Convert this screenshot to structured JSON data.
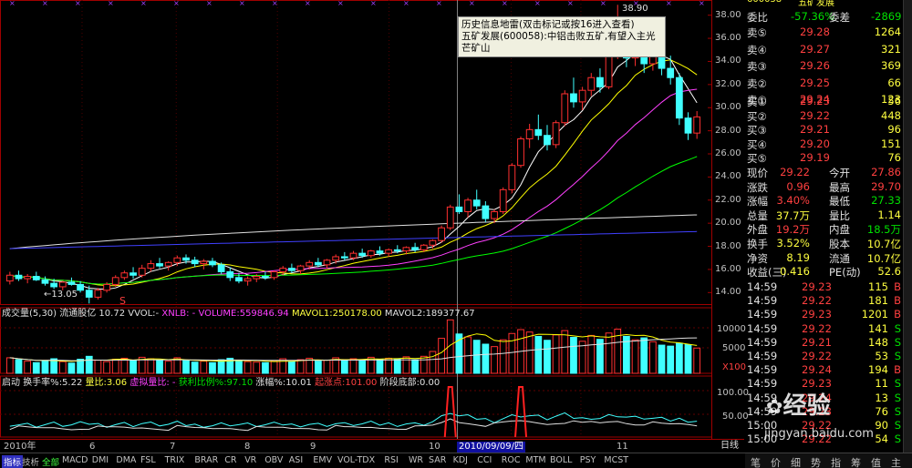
{
  "stock": {
    "code": "600058",
    "name": "五矿发展"
  },
  "tooltip": {
    "line1": "历史信息地雷(双击标记或按16进入查看)",
    "line2": "五矿发展(600058):中铝击败五矿,有望入主光芒矿山"
  },
  "price_axis": [
    "38.00",
    "36.00",
    "34.00",
    "32.00",
    "30.00",
    "28.00",
    "26.00",
    "24.00",
    "22.00",
    "20.00",
    "18.00",
    "16.00",
    "14.00"
  ],
  "price_markers": {
    "high": "38.90",
    "low": "13.05",
    "s_marker": "S"
  },
  "indicators": {
    "vol_title": "成交量(5,30) 流通股亿 10.72 VVOL:-",
    "vol_xnlb": "XNLB: - VOLUME:559846.94",
    "vol_mavol1": "MAVOL1:250178.00",
    "vol_mavol2": "MAVOL2:189377.67",
    "vol_axis_top": "10000",
    "vol_axis_mid": "5000",
    "vol_axis_unit": "X100",
    "qd_title": "启动",
    "qd_turnover": "换手率%:5.22",
    "qd_ratio": "量比:3.06",
    "qd_vratio": "虚拟量比: -",
    "qd_profit": "获利比例%:97.10",
    "qd_amp": "涨幅%:10.01",
    "qd_start": "起涨点:101.00",
    "qd_stage": "阶段底部:0.00",
    "qd_axis_top": "100.00",
    "qd_axis_mid": "50.00"
  },
  "x_axis": {
    "labels": [
      "2010年",
      "6",
      "7",
      "8",
      "9",
      "10",
      "11"
    ],
    "cursor_date": "2010/09/09/四",
    "end_label": "日线"
  },
  "quote": {
    "weibi_label": "委比",
    "weibi_value": "-57.36%",
    "weicha_label": "委差",
    "weicha_value": "-2869",
    "sells": [
      {
        "label": "卖⑤",
        "price": "29.28",
        "vol": "1264"
      },
      {
        "label": "卖④",
        "price": "29.27",
        "vol": "321"
      },
      {
        "label": "卖③",
        "price": "29.26",
        "vol": "369"
      },
      {
        "label": "卖②",
        "price": "29.25",
        "vol": "66"
      },
      {
        "label": "卖①",
        "price": "29.24",
        "vol": "123"
      }
    ],
    "buys": [
      {
        "label": "买①",
        "price": "29.23",
        "vol": "56"
      },
      {
        "label": "买②",
        "price": "29.22",
        "vol": "448"
      },
      {
        "label": "买③",
        "price": "29.21",
        "vol": "96"
      },
      {
        "label": "买④",
        "price": "29.20",
        "vol": "151"
      },
      {
        "label": "买⑤",
        "price": "29.19",
        "vol": "76"
      }
    ],
    "stats": [
      {
        "l1": "现价",
        "v1": "29.22",
        "l2": "今开",
        "v2": "27.86"
      },
      {
        "l1": "涨跌",
        "v1": "0.96",
        "l2": "最高",
        "v2": "29.70"
      },
      {
        "l1": "涨幅",
        "v1": "3.40%",
        "l2": "最低",
        "v2": "27.33"
      },
      {
        "l1": "总量",
        "v1": "37.7万",
        "l2": "量比",
        "v2": "1.14"
      },
      {
        "l1": "外盘",
        "v1": "19.2万",
        "l2": "内盘",
        "v2": "18.5万"
      }
    ],
    "stats2": [
      {
        "l1": "换手",
        "v1": "3.52%",
        "l2": "股本",
        "v2": "10.7亿"
      },
      {
        "l1": "净资",
        "v1": "8.19",
        "l2": "流通",
        "v2": "10.7亿"
      },
      {
        "l1": "收益(三)",
        "v1": "0.416",
        "l2": "PE(动)",
        "v2": "52.6"
      }
    ],
    "ticks": [
      {
        "time": "14:59",
        "price": "29.23",
        "vol": "115",
        "bs": "B"
      },
      {
        "time": "14:59",
        "price": "29.22",
        "vol": "181",
        "bs": "B"
      },
      {
        "time": "14:59",
        "price": "29.23",
        "vol": "1201",
        "bs": "B"
      },
      {
        "time": "14:59",
        "price": "29.22",
        "vol": "141",
        "bs": "S"
      },
      {
        "time": "14:59",
        "price": "29.21",
        "vol": "148",
        "bs": "S"
      },
      {
        "time": "14:59",
        "price": "29.22",
        "vol": "53",
        "bs": "S"
      },
      {
        "time": "14:59",
        "price": "29.24",
        "vol": "194",
        "bs": "B"
      },
      {
        "time": "14:59",
        "price": "29.23",
        "vol": "11",
        "bs": "S"
      },
      {
        "time": "14:59",
        "price": "29.24",
        "vol": "13",
        "bs": "S"
      },
      {
        "time": "14:59",
        "price": "29.23",
        "vol": "76",
        "bs": "S"
      },
      {
        "time": "15:00",
        "price": "29.22",
        "vol": "90",
        "bs": "S"
      },
      {
        "time": "15:00",
        "price": "29.22",
        "vol": "54",
        "bs": "S"
      }
    ]
  },
  "bottom_tabs": [
    "指标",
    "技析",
    "全部",
    "MACD",
    "DMI",
    "DMA",
    "FSL",
    "TRIX",
    "BRAR",
    "CR",
    "VR",
    "OBV",
    "ASI",
    "EMV",
    "VOL-TDX",
    "RSI",
    "WR",
    "SAR",
    "KDJ",
    "CCI",
    "ROC",
    "MTM",
    "BOLL",
    "PSY",
    "MCST"
  ],
  "right_tabs": [
    "笔",
    "价",
    "细",
    "势",
    "指",
    "筹",
    "值",
    "主"
  ],
  "watermark": {
    "text": "经验",
    "url": "jingyan.baidu.com"
  },
  "chart_data": {
    "type": "candlestick",
    "candles": [
      [
        15.0,
        15.8,
        14.7,
        15.5
      ],
      [
        15.5,
        15.9,
        15.0,
        15.2
      ],
      [
        15.2,
        15.6,
        14.8,
        15.4
      ],
      [
        15.4,
        15.8,
        15.0,
        15.1
      ],
      [
        15.1,
        15.4,
        14.6,
        14.8
      ],
      [
        14.8,
        15.2,
        14.3,
        14.5
      ],
      [
        14.5,
        15.0,
        14.2,
        14.9
      ],
      [
        14.9,
        15.3,
        14.6,
        14.7
      ],
      [
        14.7,
        15.0,
        14.0,
        14.2
      ],
      [
        14.2,
        14.6,
        13.05,
        13.6
      ],
      [
        13.6,
        14.4,
        13.4,
        14.2
      ],
      [
        14.2,
        14.9,
        14.0,
        14.7
      ],
      [
        14.7,
        15.5,
        14.5,
        15.3
      ],
      [
        15.3,
        15.9,
        15.1,
        15.7
      ],
      [
        15.7,
        16.2,
        15.2,
        15.5
      ],
      [
        15.5,
        16.4,
        15.3,
        16.1
      ],
      [
        16.1,
        16.8,
        15.8,
        16.5
      ],
      [
        16.5,
        17.0,
        16.1,
        16.3
      ],
      [
        16.3,
        16.7,
        15.9,
        16.6
      ],
      [
        16.6,
        17.2,
        16.3,
        17.0
      ],
      [
        17.0,
        17.3,
        16.5,
        16.8
      ],
      [
        16.8,
        17.1,
        16.2,
        16.5
      ],
      [
        16.5,
        16.9,
        16.0,
        16.7
      ],
      [
        16.7,
        17.0,
        16.2,
        16.4
      ],
      [
        16.4,
        16.6,
        15.6,
        15.8
      ],
      [
        15.8,
        16.2,
        15.0,
        15.3
      ],
      [
        15.3,
        15.7,
        14.8,
        15.0
      ],
      [
        15.0,
        15.4,
        14.6,
        15.2
      ],
      [
        15.2,
        15.6,
        14.9,
        15.4
      ],
      [
        15.4,
        15.8,
        15.1,
        15.3
      ],
      [
        15.3,
        15.9,
        15.1,
        15.8
      ],
      [
        15.8,
        16.3,
        15.5,
        16.1
      ],
      [
        16.1,
        16.5,
        15.7,
        15.9
      ],
      [
        15.9,
        16.4,
        15.6,
        16.3
      ],
      [
        16.3,
        16.8,
        16.0,
        16.6
      ],
      [
        16.6,
        17.0,
        16.2,
        16.4
      ],
      [
        16.4,
        16.9,
        16.1,
        16.8
      ],
      [
        16.8,
        17.3,
        16.5,
        17.1
      ],
      [
        17.1,
        17.5,
        16.8,
        17.0
      ],
      [
        17.0,
        17.6,
        16.8,
        17.4
      ],
      [
        17.4,
        17.8,
        17.0,
        17.2
      ],
      [
        17.2,
        17.7,
        17.0,
        17.6
      ],
      [
        17.6,
        18.0,
        17.2,
        17.4
      ],
      [
        17.4,
        17.8,
        17.1,
        17.7
      ],
      [
        17.7,
        18.1,
        17.4,
        17.6
      ],
      [
        17.6,
        18.0,
        17.3,
        17.9
      ],
      [
        17.9,
        18.3,
        17.5,
        17.7
      ],
      [
        17.7,
        18.2,
        17.5,
        18.1
      ],
      [
        18.1,
        18.6,
        17.8,
        18.5
      ],
      [
        18.5,
        19.8,
        18.3,
        19.6
      ],
      [
        19.6,
        21.6,
        19.4,
        21.4
      ],
      [
        21.4,
        22.5,
        20.8,
        21.0
      ],
      [
        21.0,
        22.2,
        20.5,
        22.0
      ],
      [
        22.0,
        22.9,
        21.2,
        21.5
      ],
      [
        21.5,
        21.9,
        20.1,
        20.4
      ],
      [
        20.4,
        21.2,
        20.0,
        21.0
      ],
      [
        21.0,
        23.1,
        20.8,
        22.9
      ],
      [
        22.9,
        25.2,
        22.6,
        25.0
      ],
      [
        25.0,
        27.5,
        24.8,
        27.3
      ],
      [
        27.3,
        28.6,
        26.5,
        28.1
      ],
      [
        28.1,
        29.4,
        27.2,
        27.6
      ],
      [
        27.6,
        28.5,
        26.3,
        26.8
      ],
      [
        26.8,
        28.9,
        26.5,
        28.7
      ],
      [
        28.7,
        31.5,
        28.4,
        31.2
      ],
      [
        31.2,
        32.6,
        30.0,
        30.5
      ],
      [
        30.5,
        31.8,
        29.8,
        31.5
      ],
      [
        31.5,
        33.0,
        31.0,
        32.6
      ],
      [
        32.6,
        33.4,
        31.3,
        31.8
      ],
      [
        31.8,
        34.9,
        31.6,
        34.6
      ],
      [
        34.6,
        38.9,
        34.2,
        37.1
      ],
      [
        37.1,
        37.6,
        33.5,
        34.3
      ],
      [
        34.3,
        36.2,
        33.6,
        35.8
      ],
      [
        35.8,
        36.8,
        33.0,
        33.8
      ],
      [
        33.8,
        35.8,
        33.2,
        35.3
      ],
      [
        35.3,
        36.3,
        32.8,
        33.4
      ],
      [
        33.4,
        34.5,
        32.0,
        32.6
      ],
      [
        32.6,
        33.0,
        28.5,
        29.1
      ],
      [
        29.1,
        29.6,
        27.2,
        27.8
      ],
      [
        27.8,
        29.7,
        27.3,
        29.2
      ]
    ],
    "ylim": [
      13,
      39
    ],
    "volumes": [
      3.2,
      2.8,
      2.5,
      2.2,
      2.6,
      3.0,
      2.4,
      2.1,
      2.9,
      3.5,
      2.7,
      2.4,
      2.9,
      3.1,
      2.6,
      3.3,
      3.0,
      2.7,
      2.5,
      3.2,
      2.6,
      2.3,
      2.5,
      2.2,
      2.8,
      3.1,
      2.6,
      2.4,
      2.3,
      2.2,
      2.6,
      3.0,
      2.4,
      2.8,
      3.1,
      2.5,
      2.7,
      3.2,
      2.6,
      3.0,
      2.8,
      3.3,
      2.9,
      3.1,
      3.0,
      3.4,
      2.8,
      3.5,
      4.5,
      7.2,
      11.0,
      8.1,
      7.5,
      6.8,
      6.0,
      5.5,
      6.9,
      8.2,
      9.0,
      8.5,
      7.6,
      6.8,
      7.9,
      8.8,
      7.4,
      6.6,
      7.8,
      7.0,
      8.3,
      9.1,
      7.6,
      6.9,
      7.3,
      6.5,
      5.8,
      5.6,
      6.2,
      5.9,
      5.2
    ],
    "vol_ylim": [
      0,
      12000
    ]
  }
}
